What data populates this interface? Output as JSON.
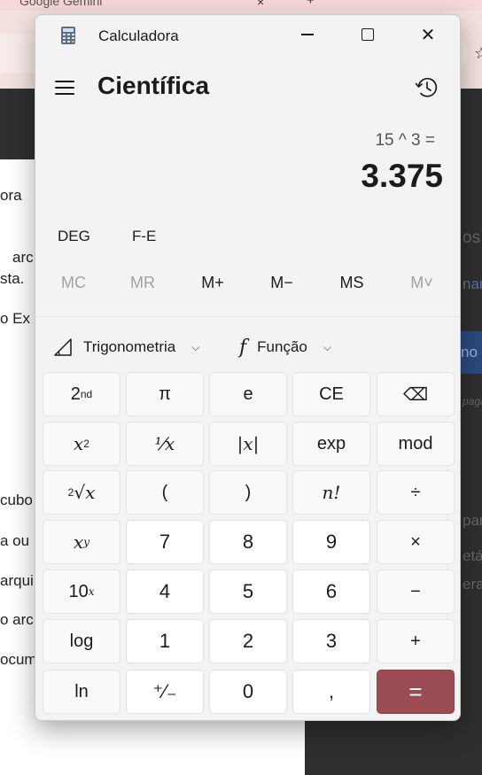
{
  "background": {
    "tab_title": "Google Gemini",
    "tab_close_glyph": "×",
    "new_tab_glyph": "+",
    "star_glyph": "☆",
    "doc_fragments": [
      "ora",
      "arc",
      "sta.",
      "o  Ex",
      "cubo",
      "a ou",
      "arqui",
      "o arc",
      "ocum"
    ],
    "right_fragments": [
      "os",
      "nar",
      "no",
      "paga",
      "par",
      "etár",
      "erar"
    ]
  },
  "window": {
    "title": "Calculadora",
    "minimize_label": "minimize",
    "maximize_label": "maximize",
    "close_glyph": "✕"
  },
  "header": {
    "mode": "Científica"
  },
  "display": {
    "expression": "15 ^ 3 =",
    "value": "3.375"
  },
  "angle": {
    "deg": "DEG",
    "fe": "F-E"
  },
  "memory": {
    "mc": "MC",
    "mr": "MR",
    "mplus": "M+",
    "mminus": "M−",
    "ms": "MS",
    "mlist": "M˅"
  },
  "dropdowns": {
    "trig": "Trigonometria",
    "func_glyph": "f",
    "func": "Função",
    "chevron": "⌵"
  },
  "keys": {
    "second": "2",
    "second_sup": "nd",
    "pi": "π",
    "e": "e",
    "ce": "CE",
    "backspace": "⌫",
    "square_base": "x",
    "square_sup": "2",
    "reciprocal": "¹⁄x",
    "abs": "|x|",
    "exp": "exp",
    "mod": "mod",
    "cuberoot_idx": "2",
    "cuberoot": "√x",
    "open_paren": "(",
    "close_paren": ")",
    "factorial": "n!",
    "divide": "÷",
    "power_base": "x",
    "power_sup": "y",
    "seven": "7",
    "eight": "8",
    "nine": "9",
    "multiply": "×",
    "tenpow_base": "10",
    "tenpow_sup": "x",
    "four": "4",
    "five": "5",
    "six": "6",
    "minus": "−",
    "log": "log",
    "one": "1",
    "two": "2",
    "three": "3",
    "plus": "+",
    "ln": "ln",
    "negate": "⁺⁄₋",
    "zero": "0",
    "decimal": ",",
    "equals": "="
  },
  "colors": {
    "equals_bg": "#9a4b54",
    "window_bg": "#f3f3f3",
    "key_bg": "#f9f9f9",
    "num_bg": "#ffffff"
  }
}
